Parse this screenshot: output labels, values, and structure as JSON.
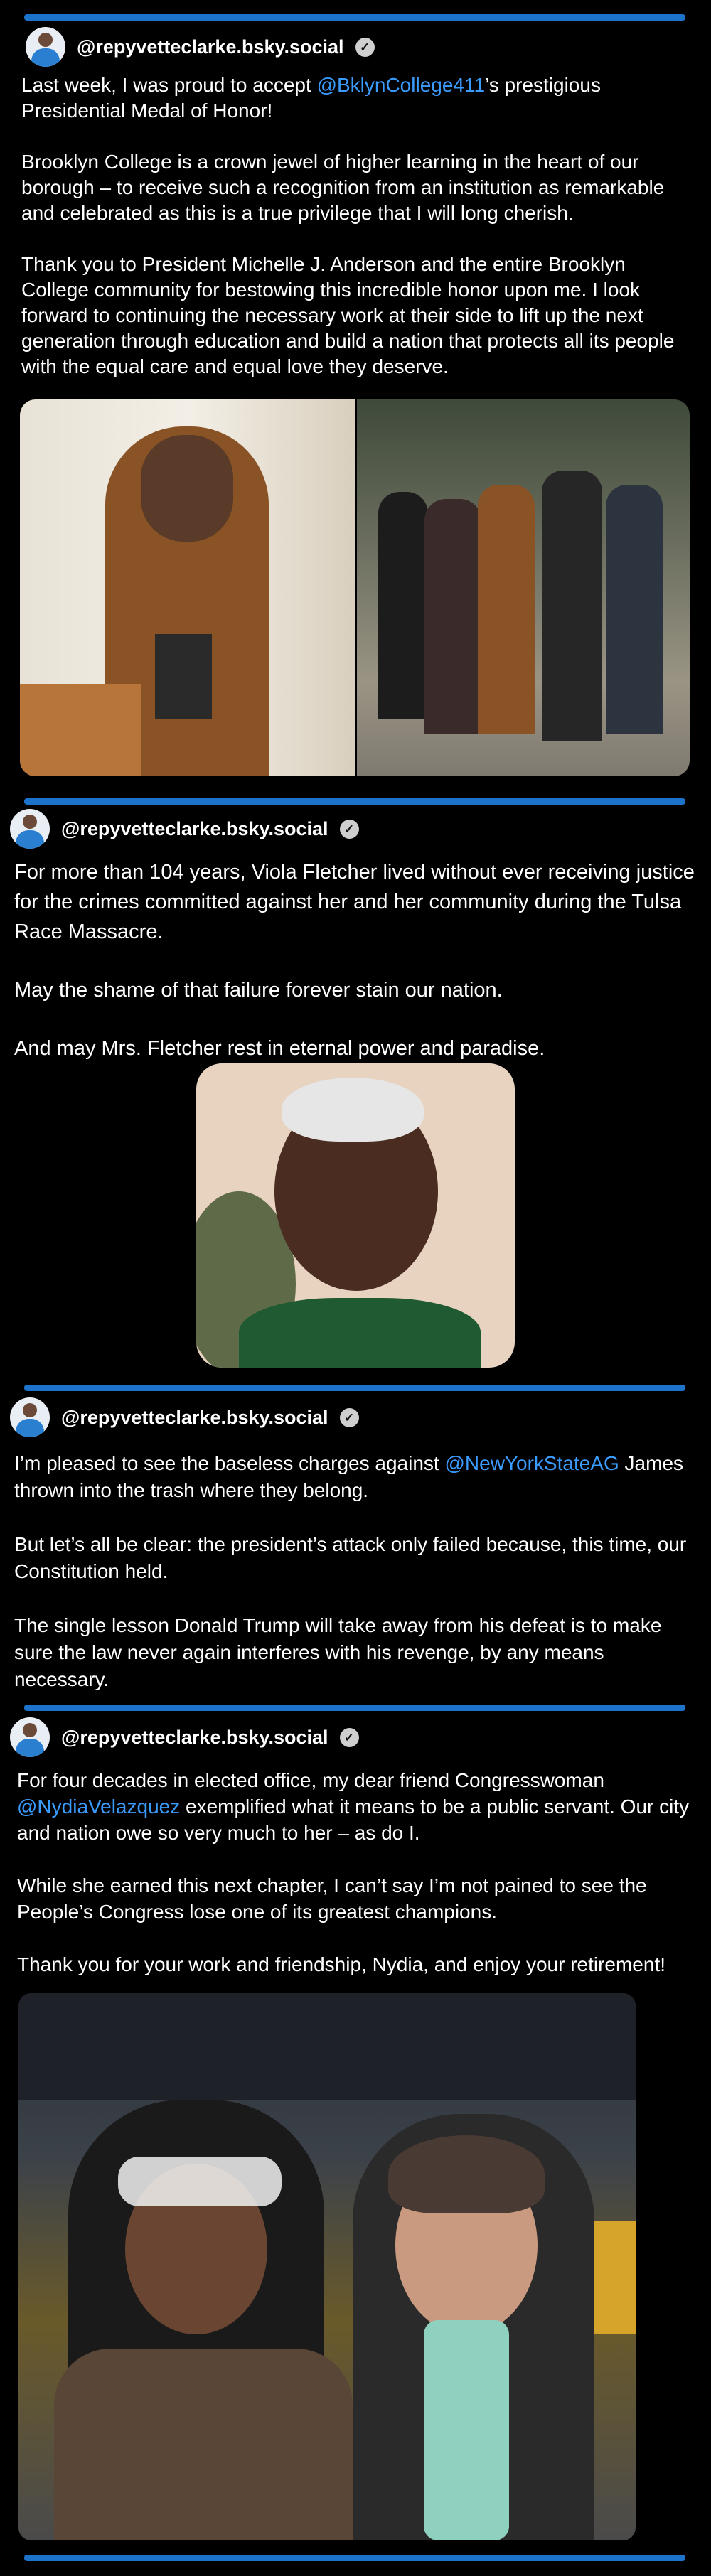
{
  "posts": [
    {
      "handle": "@repyvetteclarke.bsky.social",
      "paragraphs": [
        {
          "before": "Last week, I was proud to accept ",
          "mention": "@BklynCollege411",
          "after": "’s prestigious Presidential Medal of Honor!"
        },
        {
          "text": "Brooklyn College is a crown jewel of higher learning in the heart of our borough – to receive such a recognition from an institution as remarkable and celebrated as this is a true privilege that I will long cherish."
        },
        {
          "text": "Thank you to President Michelle J. Anderson and the entire Brooklyn College community for bestowing this incredible honor upon me. I look forward to continuing the necessary work at their side to lift up the next generation through education and build a nation that protects all its people with the equal care and equal love they deserve."
        }
      ]
    },
    {
      "handle": "@repyvetteclarke.bsky.social",
      "paragraphs": [
        {
          "text": "For more than 104 years, Viola Fletcher lived without ever receiving justice for the crimes committed against her and her community during the Tulsa Race Massacre."
        },
        {
          "text": "May the shame of that failure forever stain our nation."
        },
        {
          "text": "And may Mrs. Fletcher rest in eternal power and paradise."
        }
      ]
    },
    {
      "handle": "@repyvetteclarke.bsky.social",
      "paragraphs": [
        {
          "before": "I’m pleased to see the baseless charges against ",
          "mention": "@NewYorkStateAG",
          "after": " James thrown into the trash where they belong."
        },
        {
          "text": "But let’s all be clear: the president’s attack only failed because, this time, our Constitution held."
        },
        {
          "text": "The single lesson Donald Trump will take away from his defeat is to make sure the law never again interferes with his revenge, by any means necessary."
        }
      ]
    },
    {
      "handle": "@repyvetteclarke.bsky.social",
      "paragraphs": [
        {
          "before": "For four decades in elected office, my dear friend Congresswoman ",
          "mention": "@NydiaVelazquez",
          "after": " exemplified what it means to be a public servant. Our city and nation owe so very much to her – as do I."
        },
        {
          "text": "While she earned this next chapter, I can’t say I’m not pained to see the People’s Congress lose one of its greatest champions."
        },
        {
          "text": "Thank you for your work and friendship, Nydia, and enjoy your retirement!"
        }
      ]
    }
  ],
  "colors": {
    "background": "#000000",
    "divider": "#1d73c9",
    "mention": "#3b9cff"
  },
  "icons": {
    "verified": "verified-badge-icon"
  }
}
